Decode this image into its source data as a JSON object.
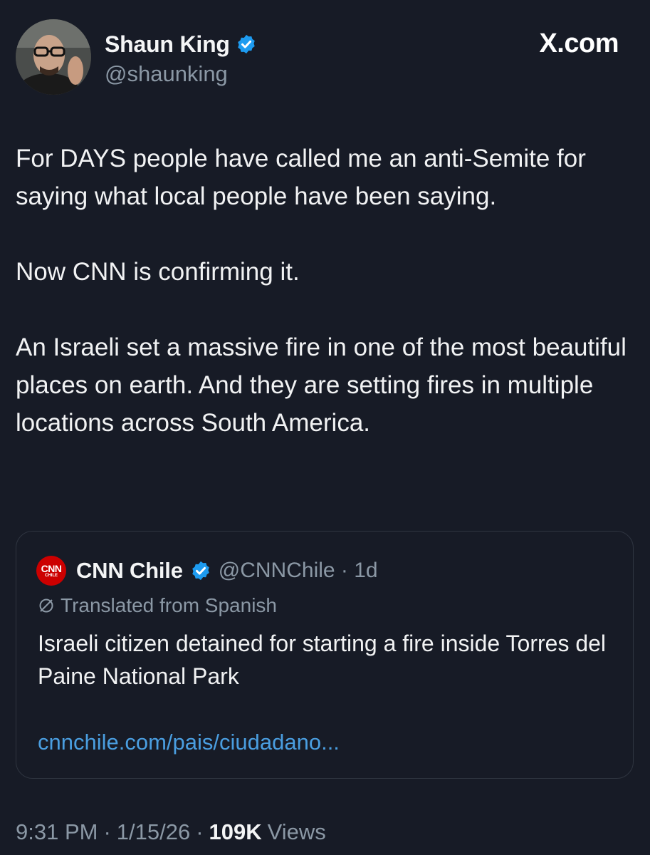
{
  "author": {
    "name": "Shaun King",
    "handle": "@shaunking",
    "verified": true
  },
  "site_label": "X.com",
  "tweet": {
    "paragraphs": [
      "For DAYS people have called me an anti-Semite for saying what local people have been saying.",
      "Now CNN is confirming it.",
      "An Israeli set a massive fire in one of the most beautiful places on earth. And they are setting fires in multiple locations across South America."
    ]
  },
  "quote": {
    "logo_text": "CNN",
    "logo_subtext": "CHILE",
    "name": "CNN Chile",
    "handle_time": "@CNNChile · 1d",
    "translated_label": "Translated from Spanish",
    "text": "Israeli citizen detained for starting a fire inside Torres del Paine National Park",
    "link": "cnnchile.com/pais/ciudadano..."
  },
  "footer": {
    "time": "9:31 PM",
    "date": "1/15/26",
    "views_count": "109K",
    "views_label": "Views"
  },
  "colors": {
    "background": "#171b26",
    "verified_badge": "#1d9bf0",
    "link": "#4a9ee0",
    "secondary_text": "#8b98a5",
    "cnn_red": "#cc0000"
  },
  "icons": {
    "verified": "verified-badge-icon",
    "translate": "globe-slash-icon"
  }
}
